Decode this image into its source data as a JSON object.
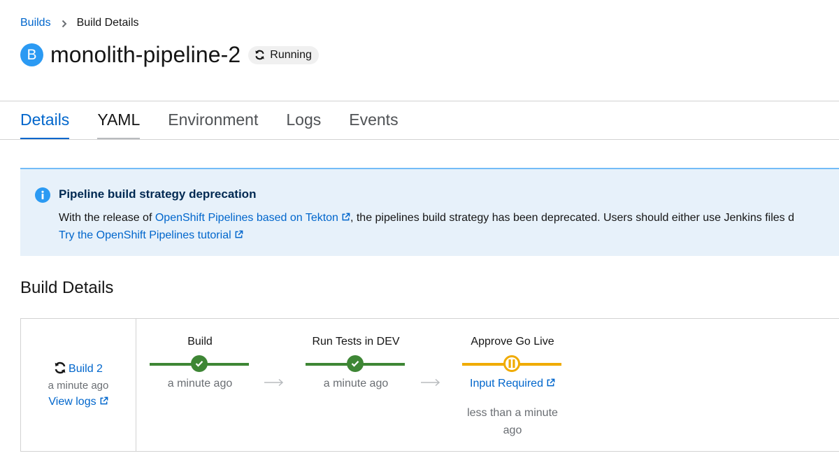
{
  "breadcrumb": {
    "parent": "Builds",
    "current": "Build Details"
  },
  "header": {
    "badge_letter": "B",
    "title": "monolith-pipeline-2",
    "status": "Running"
  },
  "tabs": [
    {
      "label": "Details",
      "state": "active"
    },
    {
      "label": "YAML",
      "state": "hover"
    },
    {
      "label": "Environment",
      "state": "default"
    },
    {
      "label": "Logs",
      "state": "default"
    },
    {
      "label": "Events",
      "state": "default"
    }
  ],
  "alert": {
    "title": "Pipeline build strategy deprecation",
    "text_before": "With the release of ",
    "link1": "OpenShift Pipelines based on Tekton",
    "text_after": ", the pipelines build strategy has been deprecated. Users should either use Jenkins files d",
    "link2": "Try the OpenShift Pipelines tutorial"
  },
  "section_title": "Build Details",
  "build": {
    "link": "Build 2",
    "time": "a minute ago",
    "logs_link": "View logs"
  },
  "stages": [
    {
      "name": "Build",
      "status": "success",
      "time": "a minute ago"
    },
    {
      "name": "Run Tests in DEV",
      "status": "success",
      "time": "a minute ago"
    },
    {
      "name": "Approve Go Live",
      "status": "paused",
      "input_link": "Input Required",
      "wait_line1": "less than a minute",
      "wait_line2": "ago"
    }
  ],
  "colors": {
    "link": "#0066cc",
    "success": "#3e8635",
    "paused": "#f0ab00",
    "alert_bg": "#e7f1fa",
    "badge": "#2b9af3"
  }
}
